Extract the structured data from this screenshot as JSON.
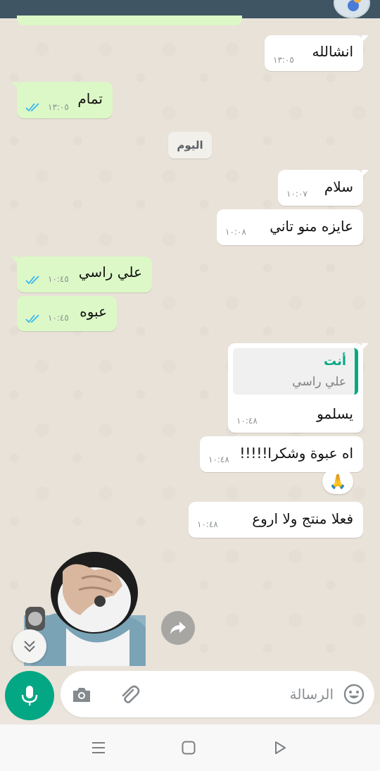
{
  "messages": [
    {
      "id": "m1",
      "dir": "in",
      "text": "انشالله",
      "time": "١٣:٠٥"
    },
    {
      "id": "m2",
      "dir": "out",
      "text": "تمام",
      "time": "١٣:٠٥"
    },
    {
      "id": "m3",
      "dir": "in",
      "text": "سلام",
      "time": "١٠:٠٧"
    },
    {
      "id": "m4",
      "dir": "in",
      "text": "عايزه منو تاني",
      "time": "١٠:٠٨"
    },
    {
      "id": "m5",
      "dir": "out",
      "text": "علي راسي",
      "time": "١٠:٤٥"
    },
    {
      "id": "m6",
      "dir": "out",
      "text": "عبوه",
      "time": "١٠:٤٥"
    },
    {
      "id": "m7",
      "dir": "in",
      "text": "يسلمو",
      "time": "١٠:٤٨",
      "quote": {
        "author": "أنت",
        "text": "علي راسي"
      }
    },
    {
      "id": "m8",
      "dir": "in",
      "text": "اه عبوة وشكرا!!!!!",
      "time": "١٠:٤٨",
      "reaction": "🙏"
    },
    {
      "id": "m9",
      "dir": "in",
      "text": "فعلا منتج ولا اروع",
      "time": "١٠:٤٨"
    }
  ],
  "day_divider": "اليوم",
  "composer": {
    "placeholder": "الرسالة"
  },
  "colors": {
    "accent": "#04a784",
    "outgoing": "#dcf8c6",
    "incoming": "#ffffff",
    "read_ticks": "#34b7f1"
  },
  "icons": {
    "mic": "mic-icon",
    "camera": "camera-icon",
    "attach": "paperclip-icon",
    "emoji": "emoji-icon",
    "forward": "forward-icon",
    "scroll": "double-chevron-down-icon",
    "nav_recents": "recents-icon",
    "nav_home": "home-icon",
    "nav_back": "back-icon"
  }
}
